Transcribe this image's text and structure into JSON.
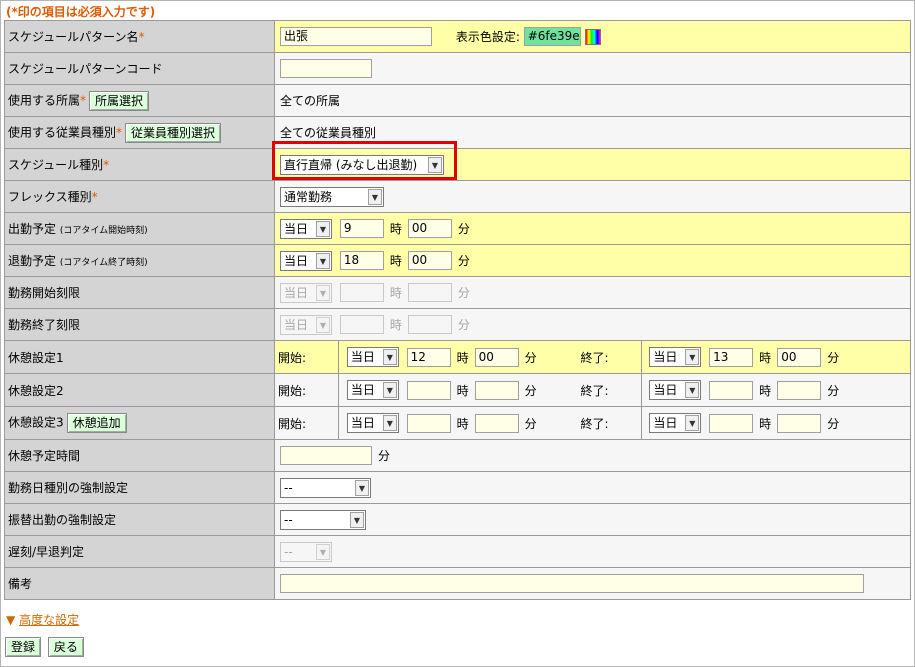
{
  "required_note": "(*印の項目は必須入力です)",
  "required_mark": "*",
  "rows": {
    "pattern_name": {
      "label": "スケジュールパターン名",
      "value": "出張",
      "color_label": "表示色設定:",
      "color_value": "#6fe39e"
    },
    "pattern_code": {
      "label": "スケジュールパターンコード",
      "value": ""
    },
    "department": {
      "label": "使用する所属",
      "button": "所属選択",
      "value": "全ての所属"
    },
    "employee_type": {
      "label": "使用する従業員種別",
      "button": "従業員種別選択",
      "value": "全ての従業員種別"
    },
    "schedule_type": {
      "label": "スケジュール種別",
      "selected": "直行直帰 (みなし出退勤)"
    },
    "flex_type": {
      "label": "フレックス種別",
      "selected": "通常勤務"
    },
    "start_plan": {
      "label": "出勤予定",
      "label_small": "(コアタイム開始時刻)",
      "day": "当日",
      "hour": "9",
      "minute": "00"
    },
    "end_plan": {
      "label": "退勤予定",
      "label_small": "(コアタイム終了時刻)",
      "day": "当日",
      "hour": "18",
      "minute": "00"
    },
    "work_start_limit": {
      "label": "勤務開始刻限",
      "day": "当日",
      "hour": "",
      "minute": ""
    },
    "work_end_limit": {
      "label": "勤務終了刻限",
      "day": "当日",
      "hour": "",
      "minute": ""
    },
    "break1": {
      "label": "休憩設定1",
      "start_day": "当日",
      "start_hour": "12",
      "start_minute": "00",
      "end_day": "当日",
      "end_hour": "13",
      "end_minute": "00"
    },
    "break2": {
      "label": "休憩設定2",
      "start_day": "当日",
      "start_hour": "",
      "start_minute": "",
      "end_day": "当日",
      "end_hour": "",
      "end_minute": ""
    },
    "break3": {
      "label": "休憩設定3",
      "button": "休憩追加",
      "start_day": "当日",
      "start_hour": "",
      "start_minute": "",
      "end_day": "当日",
      "end_hour": "",
      "end_minute": ""
    },
    "break_plan_time": {
      "label": "休憩予定時間",
      "value": ""
    },
    "workday_force": {
      "label": "勤務日種別の強制設定",
      "selected": "--"
    },
    "substitute_force": {
      "label": "振替出勤の強制設定",
      "selected": "--"
    },
    "late_early": {
      "label": "遅刻/早退判定",
      "selected": "--"
    },
    "remarks": {
      "label": "備考",
      "value": ""
    }
  },
  "units": {
    "hour": "時",
    "minute": "分",
    "start": "開始:",
    "end": "終了:"
  },
  "advanced_link": {
    "arrow": "▼",
    "label": "高度な設定"
  },
  "footer": {
    "register": "登録",
    "back": "戻る"
  }
}
